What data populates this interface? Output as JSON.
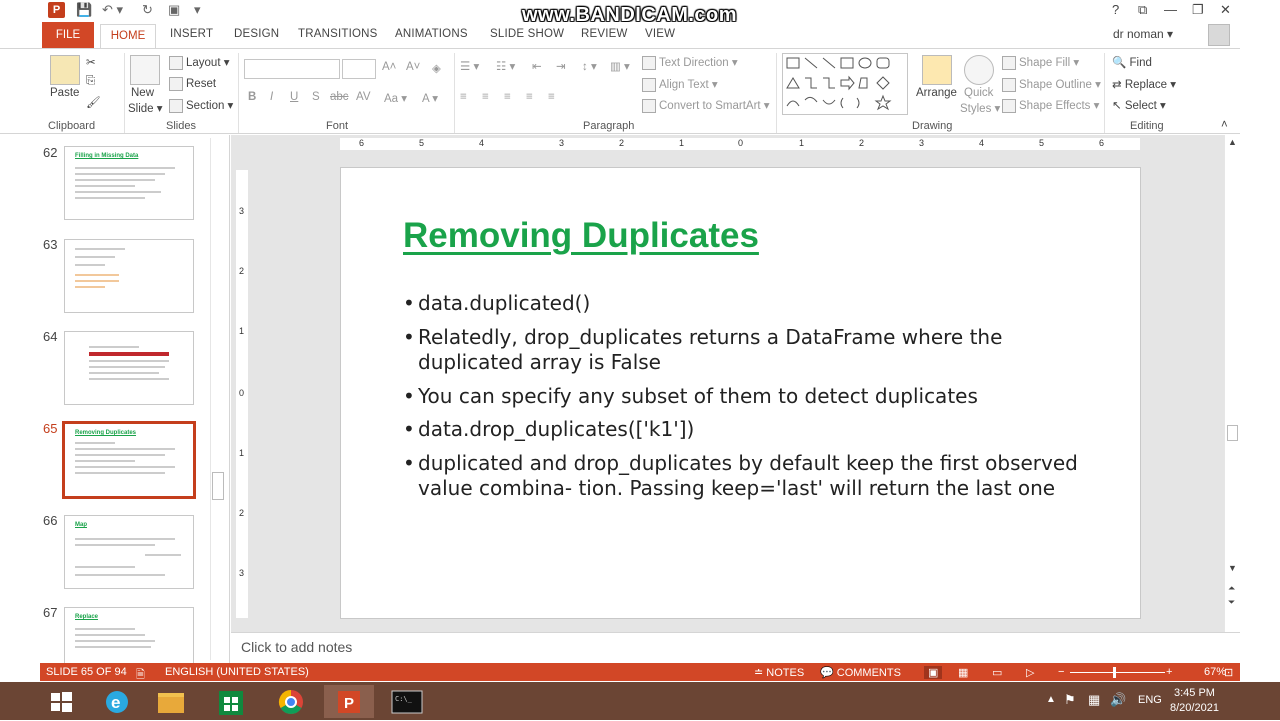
{
  "watermark": "www.BANDICAM.com",
  "window_controls": {
    "help": "?",
    "ribbon_display": "⧉",
    "minimize": "—",
    "restore": "❐",
    "close": "✕"
  },
  "tabs": [
    {
      "label": "FILE"
    },
    {
      "label": "HOME"
    },
    {
      "label": "INSERT"
    },
    {
      "label": "DESIGN"
    },
    {
      "label": "TRANSITIONS"
    },
    {
      "label": "ANIMATIONS"
    },
    {
      "label": "SLIDE SHOW"
    },
    {
      "label": "REVIEW"
    },
    {
      "label": "VIEW"
    }
  ],
  "user": {
    "name": "dr noman ▾"
  },
  "ribbon": {
    "clipboard": {
      "paste": "Paste",
      "label": "Clipboard"
    },
    "slides": {
      "new_slide_1": "New",
      "new_slide_2": "Slide ▾",
      "layout": "Layout ▾",
      "reset": "Reset",
      "section": "Section ▾",
      "label": "Slides"
    },
    "font": {
      "label": "Font",
      "bold": "B",
      "italic": "I",
      "underline": "U",
      "shadow": "S",
      "strike": "abc",
      "spacing": "AV",
      "case": "Aa ▾",
      "color": "A ▾",
      "grow": "A˄",
      "shrink": "A˅"
    },
    "paragraph": {
      "label": "Paragraph",
      "text_direction": "Text Direction ▾",
      "align_text": "Align Text ▾",
      "convert_smartart": "Convert to SmartArt ▾"
    },
    "drawing": {
      "label": "Drawing",
      "arrange": "Arrange",
      "quick_styles_1": "Quick",
      "quick_styles_2": "Styles ▾",
      "shape_fill": "Shape Fill ▾",
      "shape_outline": "Shape Outline ▾",
      "shape_effects": "Shape Effects ▾"
    },
    "editing": {
      "label": "Editing",
      "find": "Find",
      "replace": "Replace ▾",
      "select": "Select ▾"
    }
  },
  "thumbnails": [
    {
      "num": "62",
      "title": "Filling in Missing Data"
    },
    {
      "num": "63",
      "title": ""
    },
    {
      "num": "64",
      "title": ""
    },
    {
      "num": "65",
      "title": "Removing Duplicates"
    },
    {
      "num": "66",
      "title": "Map"
    },
    {
      "num": "67",
      "title": "Replace"
    }
  ],
  "slide": {
    "title": "Removing Duplicates",
    "bullets": [
      "data.duplicated()",
      "Relatedly, drop_duplicates returns a DataFrame where the duplicated array is False",
      "You can specify any subset of them to detect duplicates",
      "data.drop_duplicates(['k1'])",
      "duplicated and drop_duplicates by default keep the first observed value combina- tion. Passing keep='last' will return the last one"
    ]
  },
  "notes_placeholder": "Click to add notes",
  "status": {
    "slide_count": "SLIDE 65 OF 94",
    "language": "ENGLISH (UNITED STATES)",
    "notes": "NOTES",
    "comments": "COMMENTS",
    "zoom": "67%",
    "zoom_fraction": 0.45
  },
  "ruler": {
    "h_ticks": [
      "6",
      "5",
      "4",
      "3",
      "2",
      "1",
      "0",
      "1",
      "2",
      "3",
      "4",
      "5",
      "6"
    ],
    "v_ticks": [
      "3",
      "2",
      "1",
      "0",
      "1",
      "2",
      "3"
    ]
  },
  "taskbar": {
    "lang": "ENG",
    "time": "3:45 PM",
    "date": "8/20/2021"
  }
}
